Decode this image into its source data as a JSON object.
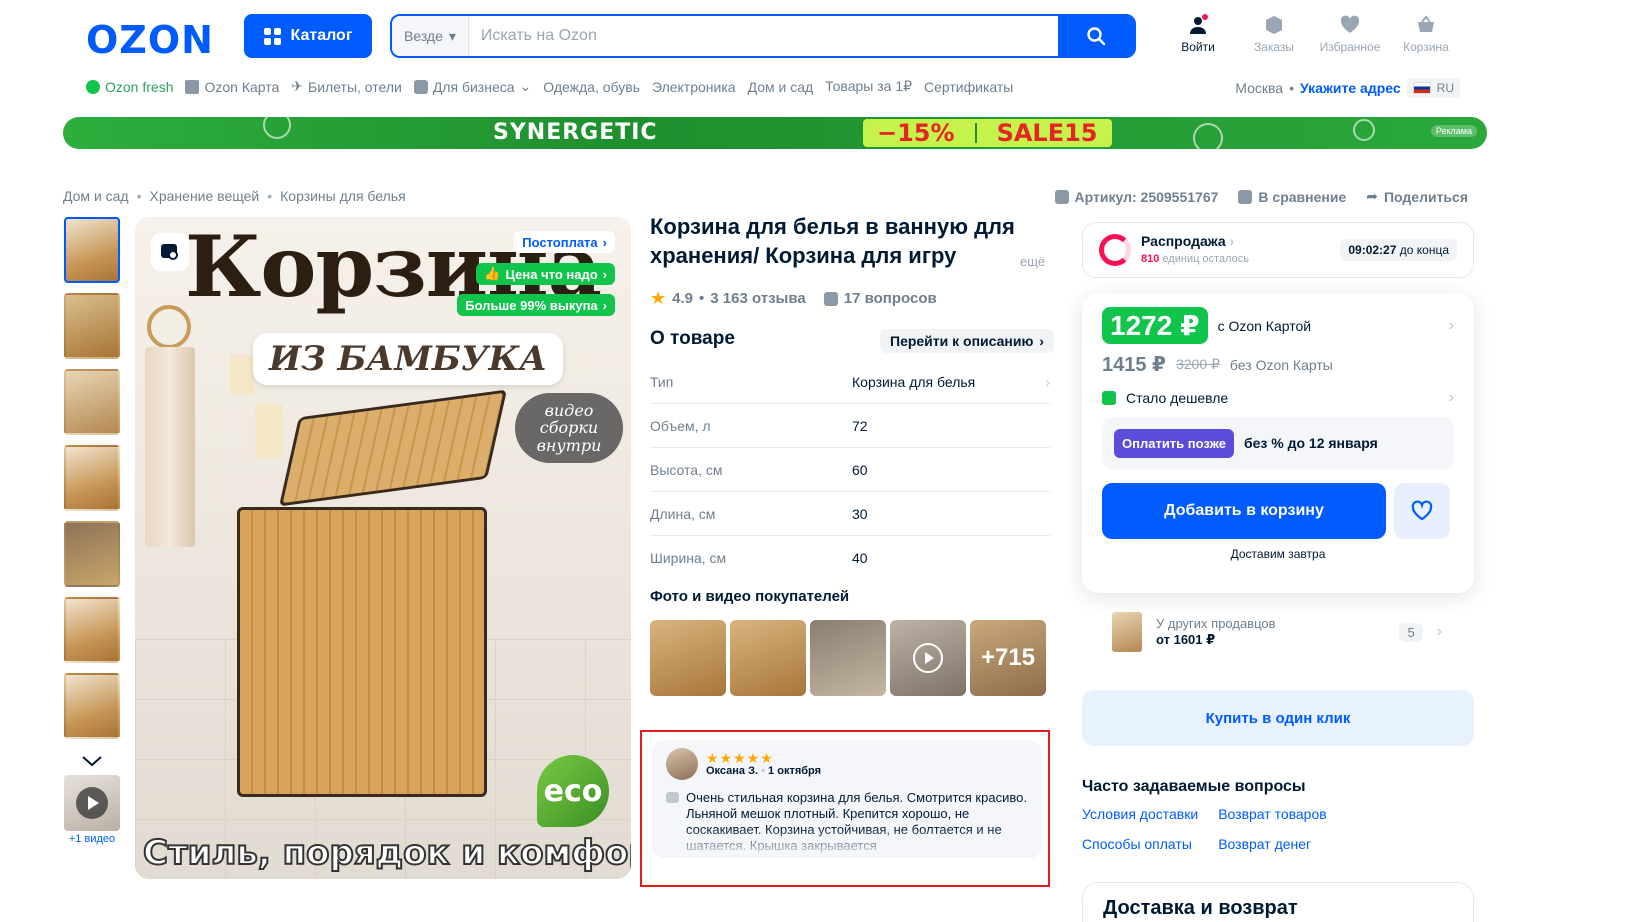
{
  "header": {
    "logo": "OZON",
    "catalog_label": "Каталог",
    "search_scope": "Везде",
    "search_placeholder": "Искать на Ozon",
    "actions": [
      {
        "label": "Войти"
      },
      {
        "label": "Заказы"
      },
      {
        "label": "Избранное"
      },
      {
        "label": "Корзина"
      }
    ]
  },
  "nav": {
    "items": [
      "Ozon fresh",
      "Ozon Карта",
      "Билеты, отели",
      "Для бизнеса",
      "Одежда, обувь",
      "Электроника",
      "Дом и сад",
      "Товары за 1₽",
      "Сертификаты"
    ],
    "city": "Москва",
    "address": "Укажите адрес",
    "lang": "RU"
  },
  "banner": {
    "brand": "SYNERGETIC",
    "discount": "−15%",
    "code": "SALE15",
    "ad": "Реклама"
  },
  "breadcrumbs": [
    "Дом и сад",
    "Хранение вещей",
    "Корзины для белья"
  ],
  "meta": {
    "article": "Артикул: 2509551767",
    "compare": "В сравнение",
    "share": "Поделиться"
  },
  "gallery": {
    "video_caption": "+1 видео",
    "image_title": "Корзина",
    "image_sub": "ИЗ БАМБУКА",
    "badge_postpay": "Постоплата",
    "badge_price": "Цена что надо",
    "badge_buyout": "Больше 99% выкупа",
    "video_note": "видео сборки внутри",
    "eco": "eco",
    "bottom_text": "Стиль, порядок и комфорт!"
  },
  "product": {
    "title": "Корзина для белья в ванную для хранения/ Корзина для игру",
    "more": "ещё",
    "rating": "4.9",
    "reviews": "3 163 отзыва",
    "questions": "17 вопросов",
    "about_title": "О товаре",
    "to_description": "Перейти к описанию",
    "specs": [
      {
        "k": "Тип",
        "v": "Корзина для белья"
      },
      {
        "k": "Объем, л",
        "v": "72"
      },
      {
        "k": "Высота, см",
        "v": "60"
      },
      {
        "k": "Длина, см",
        "v": "30"
      },
      {
        "k": "Ширина, см",
        "v": "40"
      }
    ],
    "ugc_title": "Фото и видео покупателей",
    "ugc_more": "+715"
  },
  "review": {
    "stars": "★★★★★",
    "author": "Оксана З.",
    "date": "1 октября",
    "text": "Очень стильная корзина для белья. Смотрится красиво. Льняной мешок плотный. Крепится хорошо, не соскакивает. Корзина устойчивая, не болтается и не шатается. Крышка закрывается"
  },
  "sale": {
    "title": "Распродажа",
    "left_count": "810",
    "left_text": "единиц осталось",
    "timer": "09:02:27",
    "timer_suffix": "до конца"
  },
  "price": {
    "ozon_price": "1272 ₽",
    "ozon_label": "с Ozon Картой",
    "price": "1415 ₽",
    "old_price": "3200 ₽",
    "no_card": "без Ozon Карты",
    "cheaper": "Стало дешевле",
    "pay_later": "Оплатить позже",
    "pay_later_desc": "без % до 12 января",
    "add_to_cart": "Добавить в корзину",
    "delivery": "Доставим завтра"
  },
  "sellers": {
    "label": "У других продавцов",
    "from": "от 1601 ₽",
    "count": "5"
  },
  "one_click": "Купить в один клик",
  "faq": {
    "title": "Часто задаваемые вопросы",
    "links": [
      "Условия доставки",
      "Возврат товаров",
      "Способы оплаты",
      "Возврат денег"
    ]
  },
  "delivery_title": "Доставка и возврат",
  "colors": {
    "accent": "#005bff",
    "green": "#10c44c",
    "sale": "#f91155"
  }
}
